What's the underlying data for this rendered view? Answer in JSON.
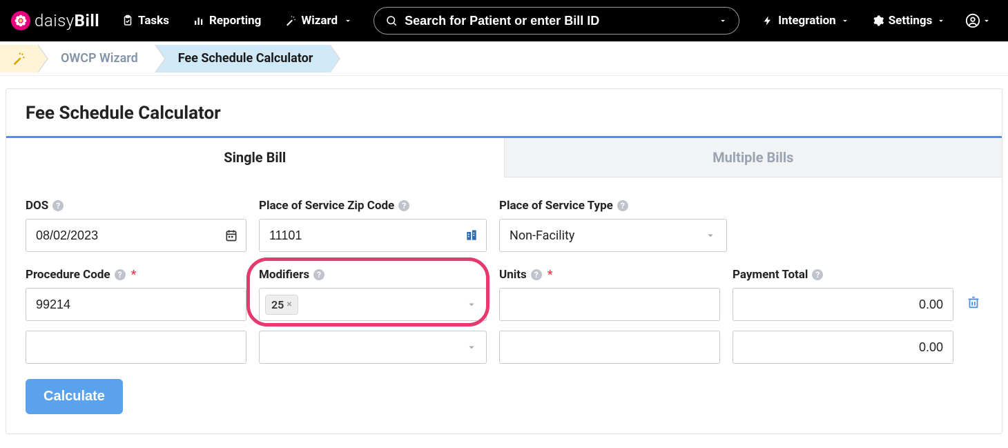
{
  "brand": {
    "name_light": "daisy",
    "name_bold": "Bill"
  },
  "nav": {
    "tasks": "Tasks",
    "reporting": "Reporting",
    "wizard": "Wizard",
    "integration": "Integration",
    "settings": "Settings"
  },
  "search": {
    "placeholder": "Search for Patient or enter Bill ID"
  },
  "breadcrumbs": {
    "owcp_wizard": "OWCP Wizard",
    "fee_calc": "Fee Schedule Calculator"
  },
  "card": {
    "title": "Fee Schedule Calculator"
  },
  "tabs": {
    "single": "Single Bill",
    "multiple": "Multiple Bills"
  },
  "labels": {
    "dos": "DOS",
    "zip": "Place of Service Zip Code",
    "pos_type": "Place of Service Type",
    "proc_code": "Procedure Code",
    "modifiers": "Modifiers",
    "units": "Units",
    "payment_total": "Payment Total"
  },
  "values": {
    "dos": "08/02/2023",
    "zip": "11101",
    "pos_type": "Non-Facility",
    "rows": [
      {
        "proc_code": "99214",
        "modifier_tags": [
          "25"
        ],
        "units": "",
        "payment_total": "0.00"
      },
      {
        "proc_code": "",
        "modifier_tags": [],
        "units": "",
        "payment_total": "0.00"
      }
    ]
  },
  "buttons": {
    "calculate": "Calculate"
  }
}
